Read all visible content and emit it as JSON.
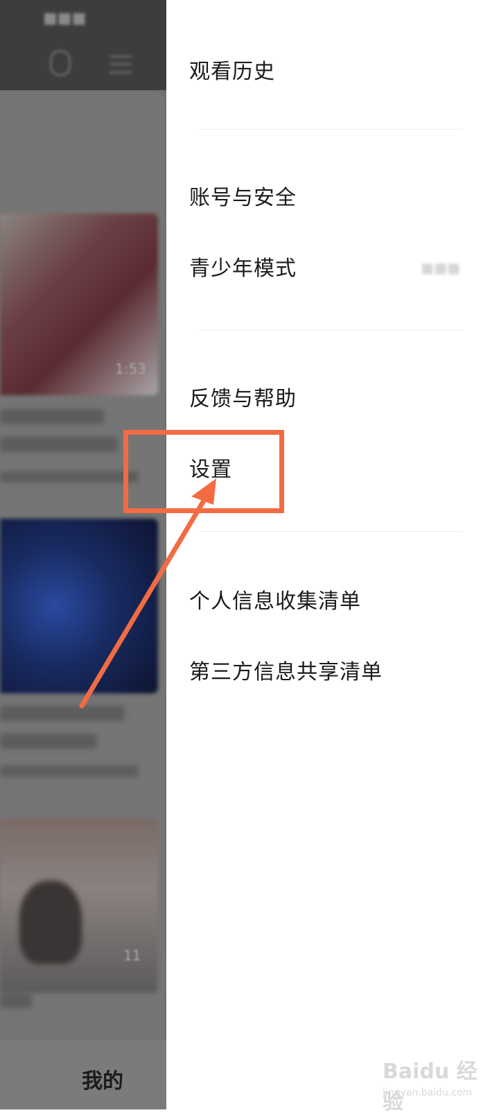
{
  "background": {
    "durations": [
      "1:53",
      "11"
    ],
    "bottom_tab_mine": "我的"
  },
  "menu": {
    "items": [
      "观看历史",
      "账号与安全",
      "青少年模式",
      "反馈与帮助",
      "设置",
      "个人信息收集清单",
      "第三方信息共享清单"
    ]
  },
  "annotation": {
    "highlight_color": "#f26b43",
    "target": "设置"
  },
  "watermark": {
    "brand": "Baidu 经验",
    "sub": "jingyan.baidu.com"
  }
}
